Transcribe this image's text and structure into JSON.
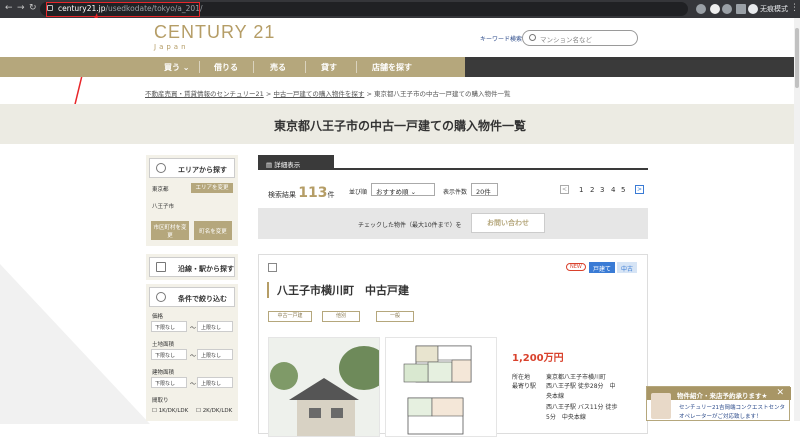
{
  "browser": {
    "url_host": "century21.jp",
    "url_path": "/usedkodate/tokyo/a_201/",
    "incognito_label": "无痕模式"
  },
  "header": {
    "brand": "CENTURY 21",
    "brand_sub": "Japan",
    "keyword_label": "キーワード検索",
    "search_placeholder": "マンション名など"
  },
  "nav": [
    "買う",
    "借りる",
    "売る",
    "貸す",
    "店舗を探す"
  ],
  "breadcrumb": {
    "items": [
      "不動産売買・賃貸情報のセンチュリー21",
      "中古一戸建ての購入物件を探す"
    ],
    "current": "東京都八王子市の中古一戸建ての購入物件一覧",
    "sep": ">"
  },
  "page_title": "東京都八王子市の中古一戸建ての購入物件一覧",
  "sidebar": {
    "area_head": "エリアから探す",
    "pref": "東京都",
    "area_change": "エリアを変更",
    "city": "八王子市",
    "btn_city": "市区町村を変更",
    "btn_town": "町名を変更",
    "line_head": "沿線・駅から探す",
    "cond_head": "条件で絞り込む",
    "price_label": "価格",
    "land_label": "土地面積",
    "build_label": "建物面積",
    "layout_label": "間取り",
    "min_sel": "下限なし",
    "max_sel": "上限なし",
    "tilde": "〜",
    "layout_1": "1K/DK/LDK",
    "layout_2": "2K/DK/LDK"
  },
  "results": {
    "tab": "詳細表示",
    "count_label": "検索結果",
    "count": "113",
    "count_unit": "件",
    "sort_label": "並び順",
    "sort_value": "おすすめ順",
    "per_page_label": "表示件数",
    "per_page_value": "20件",
    "pages": [
      "1",
      "2",
      "3",
      "4",
      "5"
    ],
    "prev": "<",
    "next": ">",
    "inquiry_label": "チェックした物件（最大10件まで）を",
    "inquiry_button": "お問い合わせ"
  },
  "listing": {
    "new_badge": "NEW",
    "tag1": "戸建て",
    "tag2": "中古",
    "title": "八王子市横川町　中古戸建",
    "cats": [
      "中古一戸建",
      "他別",
      "一般"
    ],
    "price": "1,200万円",
    "addr_label": "所在地",
    "addr": "東京都八王子市横川町",
    "station_label": "最寄り駅",
    "station1": "西八王子駅 徒歩28分　中",
    "station2": "央本線",
    "station3": "西八王子駅 バス11分 徒歩",
    "station4": "5分　中央本線"
  },
  "chat": {
    "title": "物件紹介・来店予約承ります★",
    "line1": "センチュリー21吉岡端コンクエストセンター",
    "line2": "オペレーターがご対応致します！"
  },
  "colors": {
    "gold": "#b5a77c",
    "dark": "#3a3a3a",
    "red": "#e8262a",
    "blue_tag": "#3a7bd5"
  }
}
